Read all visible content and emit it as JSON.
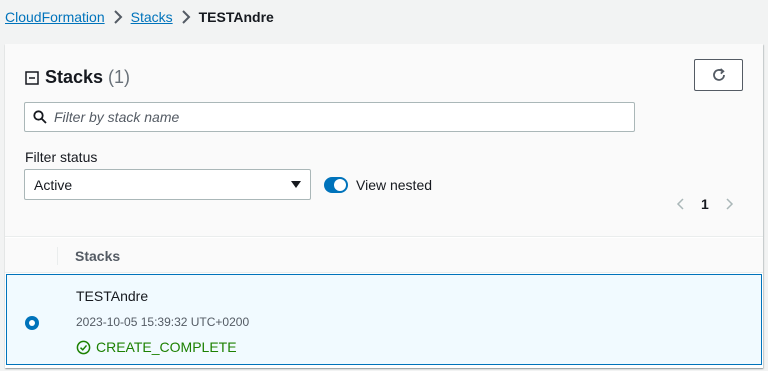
{
  "breadcrumb": {
    "items": [
      "CloudFormation",
      "Stacks"
    ],
    "current": "TESTAndre"
  },
  "panel": {
    "title": "Stacks",
    "count": "(1)",
    "search_placeholder": "Filter by stack name",
    "filter_status_label": "Filter status",
    "filter_status_value": "Active",
    "view_nested_label": "View nested",
    "view_nested_on": true,
    "page_number": "1"
  },
  "table": {
    "column_header": "Stacks",
    "rows": [
      {
        "name": "TESTAndre",
        "timestamp": "2023-10-05 15:39:32 UTC+0200",
        "status": "CREATE_COMPLETE",
        "selected": true
      }
    ]
  },
  "colors": {
    "link": "#0073bb",
    "accent": "#0073bb",
    "success": "#1d8102",
    "selected_row_bg": "#f1faff"
  },
  "icons": [
    "chevron-right-icon",
    "collapse-icon",
    "refresh-icon",
    "search-icon",
    "caret-down-icon",
    "angle-left-icon",
    "angle-right-icon",
    "check-circle-icon"
  ]
}
